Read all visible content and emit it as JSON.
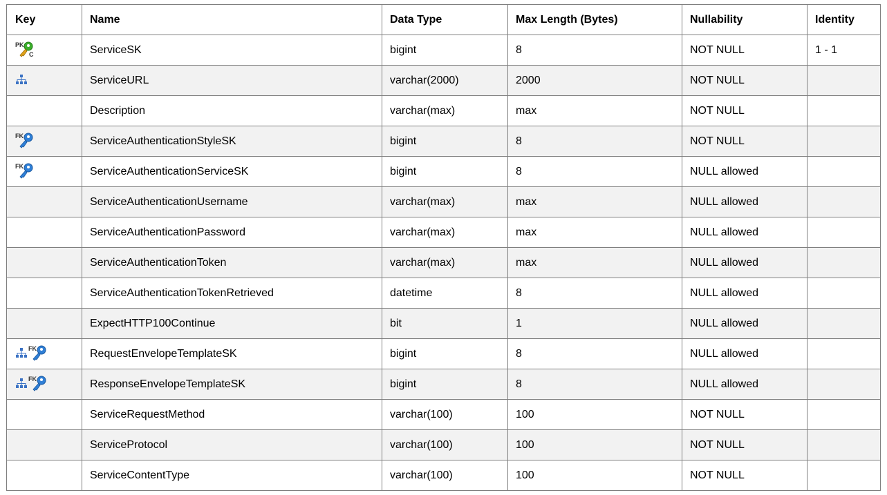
{
  "columns": {
    "key": "Key",
    "name": "Name",
    "data_type": "Data Type",
    "max_length": "Max Length (Bytes)",
    "nullability": "Nullability",
    "identity": "Identity"
  },
  "rows": [
    {
      "icons": [
        "pk-fk-key-icon"
      ],
      "name": "ServiceSK",
      "data_type": "bigint",
      "max_length": "8",
      "nullability": "NOT NULL",
      "identity": "1 - 1"
    },
    {
      "icons": [
        "index-icon"
      ],
      "name": "ServiceURL",
      "data_type": "varchar(2000)",
      "max_length": "2000",
      "nullability": "NOT NULL",
      "identity": ""
    },
    {
      "icons": [],
      "name": "Description",
      "data_type": "varchar(max)",
      "max_length": "max",
      "nullability": "NOT NULL",
      "identity": ""
    },
    {
      "icons": [
        "fk-key-icon"
      ],
      "name": "ServiceAuthenticationStyleSK",
      "data_type": "bigint",
      "max_length": "8",
      "nullability": "NOT NULL",
      "identity": ""
    },
    {
      "icons": [
        "fk-key-icon"
      ],
      "name": "ServiceAuthenticationServiceSK",
      "data_type": "bigint",
      "max_length": "8",
      "nullability": "NULL allowed",
      "identity": ""
    },
    {
      "icons": [],
      "name": "ServiceAuthenticationUsername",
      "data_type": "varchar(max)",
      "max_length": "max",
      "nullability": "NULL allowed",
      "identity": ""
    },
    {
      "icons": [],
      "name": "ServiceAuthenticationPassword",
      "data_type": "varchar(max)",
      "max_length": "max",
      "nullability": "NULL allowed",
      "identity": ""
    },
    {
      "icons": [],
      "name": "ServiceAuthenticationToken",
      "data_type": "varchar(max)",
      "max_length": "max",
      "nullability": "NULL allowed",
      "identity": ""
    },
    {
      "icons": [],
      "name": "ServiceAuthenticationTokenRetrieved",
      "data_type": "datetime",
      "max_length": "8",
      "nullability": "NULL allowed",
      "identity": ""
    },
    {
      "icons": [],
      "name": "ExpectHTTP100Continue",
      "data_type": "bit",
      "max_length": "1",
      "nullability": "NULL allowed",
      "identity": ""
    },
    {
      "icons": [
        "index-icon",
        "fk-key-icon"
      ],
      "name": "RequestEnvelopeTemplateSK",
      "data_type": "bigint",
      "max_length": "8",
      "nullability": "NULL allowed",
      "identity": ""
    },
    {
      "icons": [
        "index-icon",
        "fk-key-icon"
      ],
      "name": "ResponseEnvelopeTemplateSK",
      "data_type": "bigint",
      "max_length": "8",
      "nullability": "NULL allowed",
      "identity": ""
    },
    {
      "icons": [],
      "name": "ServiceRequestMethod",
      "data_type": "varchar(100)",
      "max_length": "100",
      "nullability": "NOT NULL",
      "identity": ""
    },
    {
      "icons": [],
      "name": "ServiceProtocol",
      "data_type": "varchar(100)",
      "max_length": "100",
      "nullability": "NOT NULL",
      "identity": ""
    },
    {
      "icons": [],
      "name": "ServiceContentType",
      "data_type": "varchar(100)",
      "max_length": "100",
      "nullability": "NOT NULL",
      "identity": ""
    }
  ],
  "icon_colors": {
    "key_blue": "#2f7fd6",
    "key_green": "#3cae2c",
    "key_gold": "#e0a21a",
    "index_blue": "#3b72c4"
  }
}
